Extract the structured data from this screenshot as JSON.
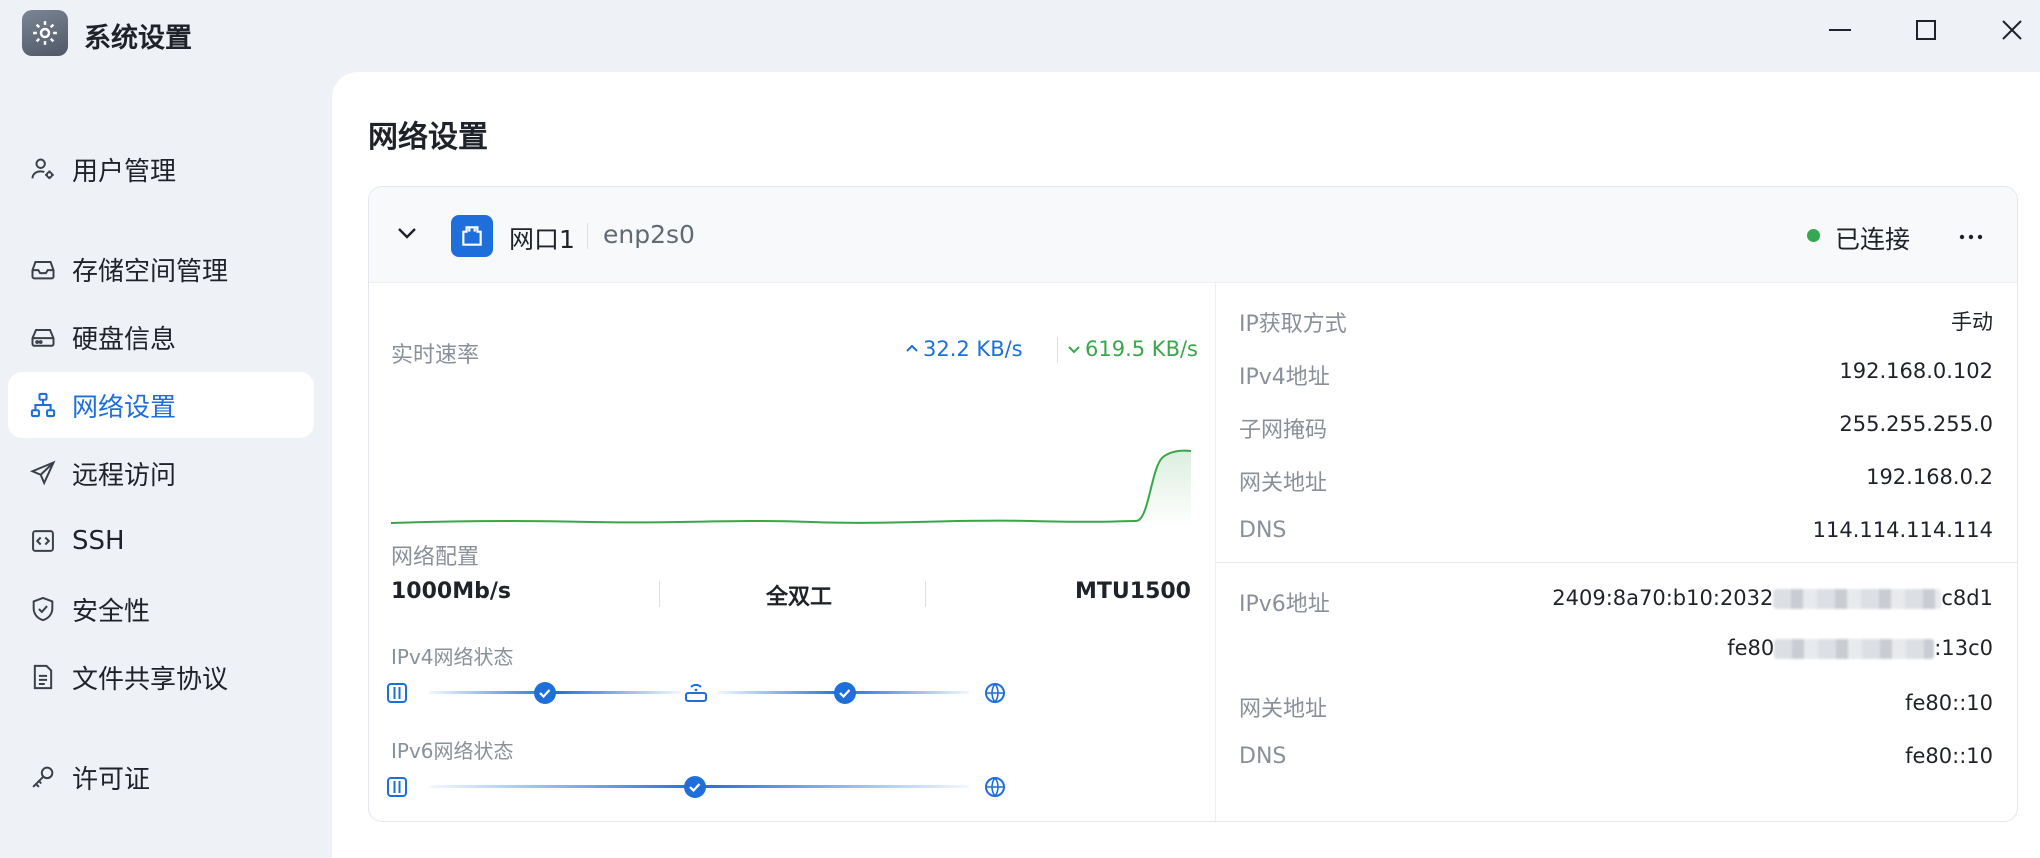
{
  "window": {
    "title": "系统设置",
    "buttons": {
      "minimize": "minimize-icon",
      "maximize": "maximize-icon",
      "close": "close-icon"
    }
  },
  "sidebar": {
    "items": [
      {
        "label": "用户管理",
        "icon": "user-settings-icon",
        "active": false
      },
      {
        "label": "存储空间管理",
        "icon": "storage-tray-icon",
        "active": false
      },
      {
        "label": "硬盘信息",
        "icon": "hard-drive-icon",
        "active": false
      },
      {
        "label": "网络设置",
        "icon": "network-topology-icon",
        "active": true
      },
      {
        "label": "远程访问",
        "icon": "paper-plane-icon",
        "active": false
      },
      {
        "label": "SSH",
        "icon": "code-box-icon",
        "active": false
      },
      {
        "label": "安全性",
        "icon": "shield-check-icon",
        "active": false
      },
      {
        "label": "文件共享协议",
        "icon": "document-icon",
        "active": false
      },
      {
        "label": "许可证",
        "icon": "key-icon",
        "active": false
      }
    ]
  },
  "main": {
    "title": "网络设置",
    "interface": {
      "name": "网口1",
      "device": "enp2s0",
      "status": "已连接",
      "status_color": "#34a853",
      "realtime": {
        "label": "实时速率",
        "upload": "32.2 KB/s",
        "download": "619.5 KB/s",
        "upload_color": "#1e6fdc",
        "download_color": "#3aa64a"
      },
      "config": {
        "label": "网络配置",
        "speed": "1000Mb/s",
        "duplex": "全双工",
        "mtu": "MTU1500"
      },
      "ipv4_status": {
        "label": "IPv4网络状态"
      },
      "ipv6_status": {
        "label": "IPv6网络状态"
      },
      "ipv4": [
        {
          "key": "IP获取方式",
          "value": "手动"
        },
        {
          "key": "IPv4地址",
          "value": "192.168.0.102"
        },
        {
          "key": "子网掩码",
          "value": "255.255.255.0"
        },
        {
          "key": "网关地址",
          "value": "192.168.0.2"
        },
        {
          "key": "DNS",
          "value": "114.114.114.114"
        }
      ],
      "ipv6": {
        "address_key": "IPv6地址",
        "address_1_start": "2409:8a70:b10:2032",
        "address_1_end": "c8d1",
        "address_2_start": "fe80",
        "address_2_end": ":13c0",
        "gateway_key": "网关地址",
        "gateway": "fe80::10",
        "dns_key": "DNS",
        "dns": "fe80::10"
      }
    }
  },
  "accent_color": "#1e6fdc"
}
